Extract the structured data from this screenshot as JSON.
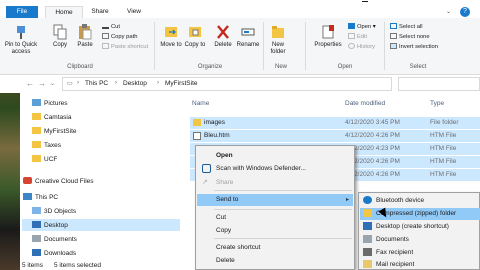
{
  "tabs": {
    "file": "File",
    "home": "Home",
    "share": "Share",
    "view": "View"
  },
  "ribbon": {
    "clipboard": {
      "pin_label": "Pin to Quick access",
      "copy_label": "Copy",
      "paste_label": "Paste",
      "cut_label": "Cut",
      "copy_path_label": "Copy path",
      "paste_shortcut_label": "Paste shortcut",
      "group_label": "Clipboard"
    },
    "organize": {
      "move_to_label": "Move to",
      "copy_to_label": "Copy to",
      "delete_label": "Delete",
      "rename_label": "Rename",
      "group_label": "Organize"
    },
    "new": {
      "new_folder_label": "New folder",
      "group_label": "New"
    },
    "open": {
      "properties_label": "Properties",
      "open_label": "Open",
      "edit_label": "Edit",
      "history_label": "History",
      "group_label": "Open"
    },
    "select": {
      "select_all_label": "Select all",
      "select_none_label": "Select none",
      "invert_selection_label": "Invert selection",
      "group_label": "Select"
    }
  },
  "address": {
    "crumbs": [
      "This PC",
      "Desktop",
      "MyFirstSite"
    ]
  },
  "nav": {
    "items": [
      "Pictures",
      "Camtasia",
      "MyFirstSite",
      "Taxes",
      "UCF",
      "Creative Cloud Files",
      "This PC",
      "3D Objects",
      "Desktop",
      "Documents",
      "Downloads"
    ]
  },
  "list": {
    "columns": {
      "name": "Name",
      "date": "Date modified",
      "type": "Type"
    },
    "rows": [
      {
        "name": "images",
        "date": "4/12/2020 3:45 PM",
        "type": "File folder"
      },
      {
        "name": "Bleu.htm",
        "date": "4/12/2020 4:26 PM",
        "type": "HTM File"
      },
      {
        "name": "",
        "date": "4/12/2020 4:23 PM",
        "type": "HTM File"
      },
      {
        "name": "",
        "date": "4/12/2020 4:26 PM",
        "type": "HTM File"
      },
      {
        "name": "",
        "date": "4/12/2020 4:26 PM",
        "type": "HTM File"
      }
    ]
  },
  "status": {
    "items": "5 items",
    "selected": "5 items selected"
  },
  "context_menu": {
    "open": "Open",
    "scan": "Scan with Windows Defender...",
    "share": "Share",
    "send_to": "Send to",
    "cut": "Cut",
    "copy": "Copy",
    "create_shortcut": "Create shortcut",
    "delete": "Delete"
  },
  "send_to_menu": {
    "items": [
      "Bluetooth device",
      "Compressed (zipped) folder",
      "Desktop (create shortcut)",
      "Documents",
      "Fax recipient",
      "Mail recipient"
    ]
  },
  "colors": {
    "accent": "#1979ca",
    "selection": "#cce8ff",
    "menu_highlight": "#91c9f7"
  }
}
